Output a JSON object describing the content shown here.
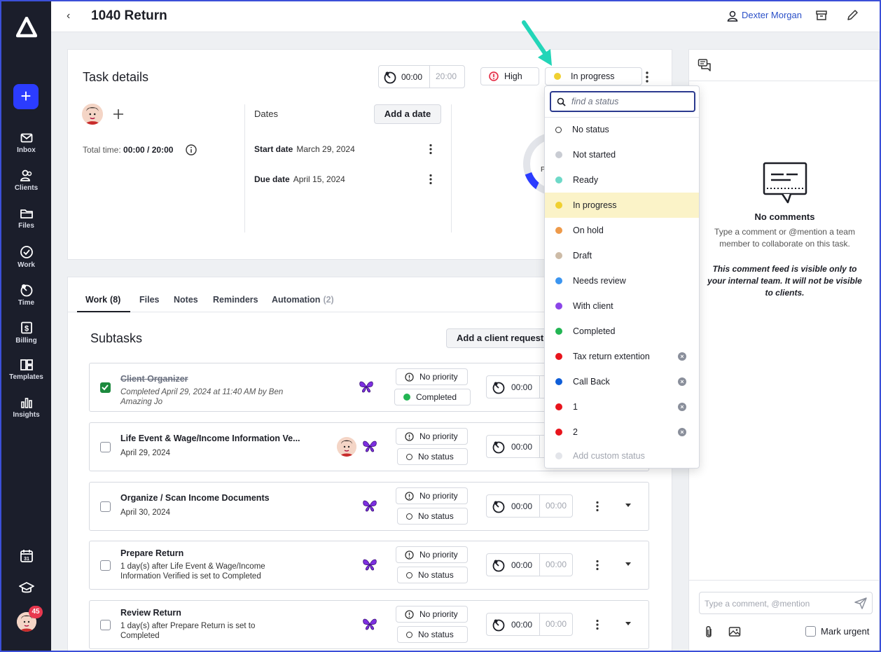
{
  "app": {
    "logo": "app-logo"
  },
  "sidebar": {
    "new_label": "+",
    "items": [
      {
        "label": "Inbox",
        "icon": "mail-icon"
      },
      {
        "label": "Clients",
        "icon": "clients-icon"
      },
      {
        "label": "Files",
        "icon": "folder-icon"
      },
      {
        "label": "Work",
        "icon": "check-circle-icon"
      },
      {
        "label": "Time",
        "icon": "clock-icon"
      },
      {
        "label": "Billing",
        "icon": "dollar-icon"
      },
      {
        "label": "Templates",
        "icon": "templates-icon"
      },
      {
        "label": "Insights",
        "icon": "bar-chart-icon"
      }
    ],
    "badge": "45"
  },
  "header": {
    "back": "‹",
    "title": "1040 Return",
    "user": "Dexter Morgan"
  },
  "task": {
    "heading": "Task details",
    "timer_value": "00:00",
    "timer_estimate": "20:00",
    "priority": "High",
    "status": "In progress",
    "total_time_label": "Total time:",
    "total_time_value": "00:00 / 20:00",
    "dates_label": "Dates",
    "add_date": "Add a date",
    "start_label": "Start date",
    "start_value": "March 29, 2024",
    "due_label": "Due date",
    "due_value": "April 15, 2024",
    "donut_partial": "P"
  },
  "work": {
    "tabs": [
      {
        "label": "Work",
        "count": "(8)"
      },
      {
        "label": "Files",
        "count": ""
      },
      {
        "label": "Notes",
        "count": ""
      },
      {
        "label": "Reminders",
        "count": ""
      },
      {
        "label": "Automation",
        "count": "(2)"
      }
    ],
    "subtasks_heading": "Subtasks",
    "add_request": "Add a client request",
    "rows": [
      {
        "title": "Client Organizer",
        "sub": "Completed April 29, 2024 at 11:40 AM by Ben Amazing Jo",
        "priority": "No priority",
        "status": "Completed",
        "timer": "00:00",
        "estimate": ""
      },
      {
        "title": "Life Event & Wage/Income Information Ve...",
        "sub": "April 29, 2024",
        "priority": "No priority",
        "status": "No status",
        "timer": "00:00",
        "estimate": ""
      },
      {
        "title": "Organize / Scan Income Documents",
        "sub": "April 30, 2024",
        "priority": "No priority",
        "status": "No status",
        "timer": "00:00",
        "estimate": "00:00"
      },
      {
        "title": "Prepare Return",
        "sub": "1 day(s) after Life Event & Wage/Income Information Verified is set to Completed",
        "priority": "No priority",
        "status": "No status",
        "timer": "00:00",
        "estimate": "00:00"
      },
      {
        "title": "Review Return",
        "sub": "1 day(s) after Prepare Return is set to Completed",
        "priority": "No priority",
        "status": "No status",
        "timer": "00:00",
        "estimate": "00:00"
      }
    ]
  },
  "comments": {
    "empty_title": "No comments",
    "empty_text": "Type a comment or @mention a team member to collaborate on this task.",
    "note": "This comment feed is visible only to your internal team. It will not be visible to clients.",
    "placeholder": "Type a comment, @mention",
    "urgent_label": "Mark urgent"
  },
  "dropdown": {
    "search_placeholder": "find a status",
    "items": [
      {
        "label": "No status",
        "color": "#ffffff",
        "removable": false
      },
      {
        "label": "Not started",
        "color": "#c9ccd3",
        "removable": false
      },
      {
        "label": "Ready",
        "color": "#6ed9c8",
        "removable": false
      },
      {
        "label": "In progress",
        "color": "#f0d030",
        "removable": false,
        "selected": true
      },
      {
        "label": "On hold",
        "color": "#ee9a4a",
        "removable": false
      },
      {
        "label": "Draft",
        "color": "#cdbba7",
        "removable": false
      },
      {
        "label": "Needs review",
        "color": "#3b95f0",
        "removable": false
      },
      {
        "label": "With client",
        "color": "#8b45e8",
        "removable": false
      },
      {
        "label": "Completed",
        "color": "#22b553",
        "removable": false
      },
      {
        "label": "Tax return extention",
        "color": "#e8141c",
        "removable": true
      },
      {
        "label": "Call Back",
        "color": "#0f5ed8",
        "removable": true
      },
      {
        "label": "1",
        "color": "#e8141c",
        "removable": true
      },
      {
        "label": "2",
        "color": "#e8141c",
        "removable": true
      }
    ],
    "add_custom": "Add custom status"
  }
}
